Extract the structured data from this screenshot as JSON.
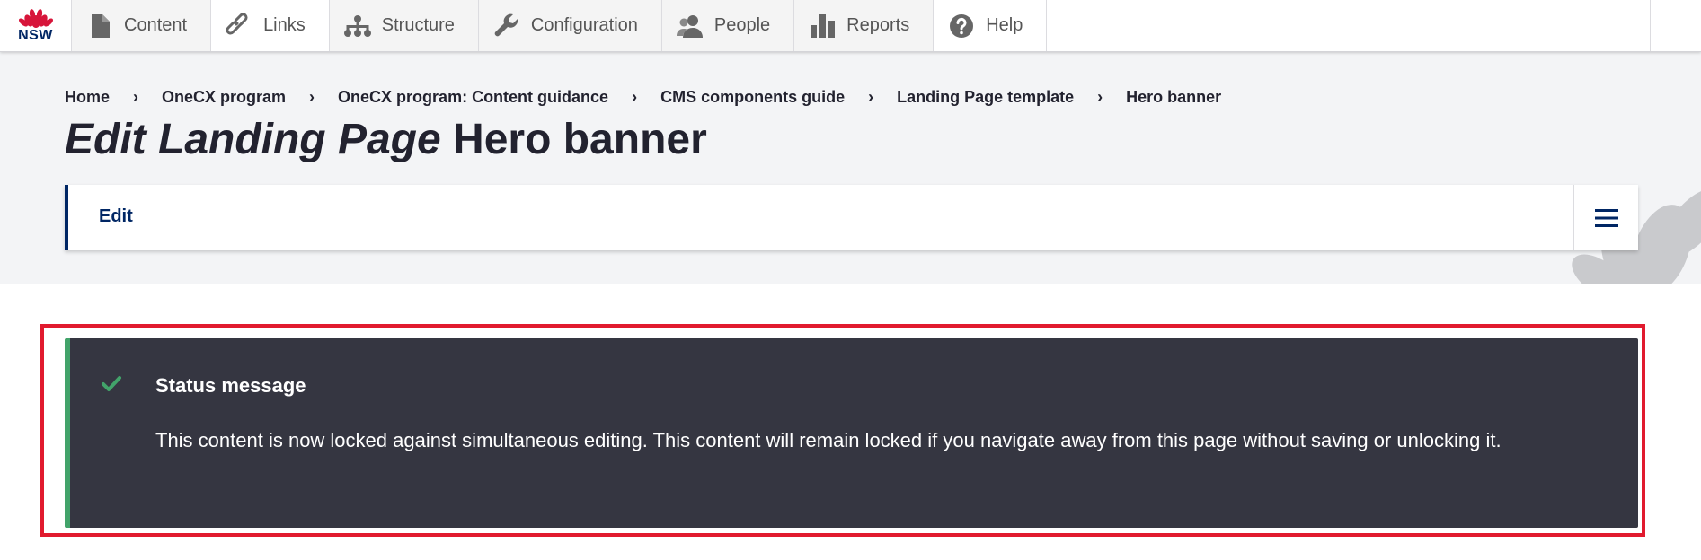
{
  "toolbar": {
    "logo_text": "NSW",
    "items": [
      {
        "label": "Content",
        "icon": "document-icon"
      },
      {
        "label": "Links",
        "icon": "link-icon"
      },
      {
        "label": "Structure",
        "icon": "sitemap-icon"
      },
      {
        "label": "Configuration",
        "icon": "wrench-icon"
      },
      {
        "label": "People",
        "icon": "people-icon"
      },
      {
        "label": "Reports",
        "icon": "bar-chart-icon"
      },
      {
        "label": "Help",
        "icon": "help-icon"
      }
    ]
  },
  "breadcrumb": [
    "Home",
    "OneCX program",
    "OneCX program: Content guidance",
    "CMS components guide",
    "Landing Page template",
    "Hero banner"
  ],
  "page": {
    "title_prefix": "Edit Landing Page",
    "title_name": "Hero banner"
  },
  "tabs": {
    "edit_label": "Edit"
  },
  "status": {
    "title": "Status message",
    "text": "This content is now locked against simultaneous editing. This content will remain locked if you navigate away from this page without saving or unlocking it."
  },
  "colors": {
    "brand_navy": "#002664",
    "brand_red": "#d7153a",
    "status_bg": "#353641",
    "status_accent": "#42a36a",
    "highlight_frame": "#e11a2e"
  }
}
